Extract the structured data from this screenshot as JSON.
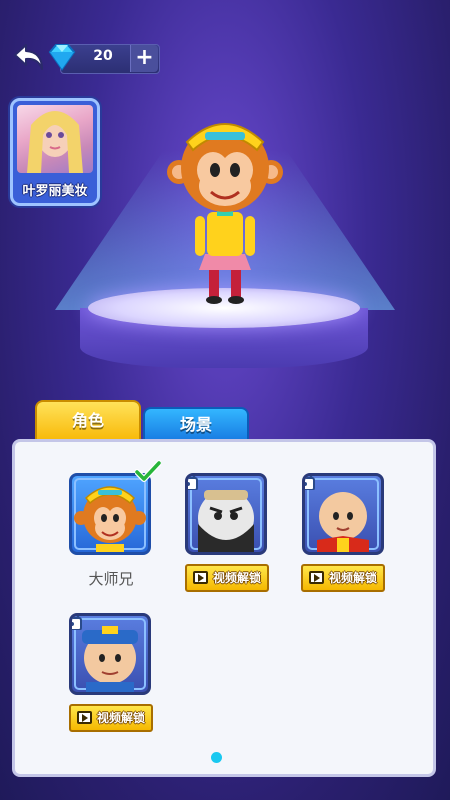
{
  "top_bar": {
    "gem_count": "20",
    "plus_label": "+"
  },
  "promo": {
    "label": "叶罗丽美妆"
  },
  "tabs": [
    {
      "label": "角色"
    },
    {
      "label": "场景"
    }
  ],
  "roles": [
    {
      "name": "大师兄",
      "status": "selected"
    },
    {
      "name": "",
      "status": "locked",
      "unlock_label": "视频解锁"
    },
    {
      "name": "",
      "status": "locked",
      "unlock_label": "视频解锁"
    },
    {
      "name": "",
      "status": "locked",
      "unlock_label": "视频解锁"
    }
  ],
  "pagination": {
    "current_page": 1,
    "total_pages": 1
  },
  "colors": {
    "tab_active": "#f7b500",
    "tab_inactive": "#1677e0",
    "button": "#f5b800",
    "accent": "#19c8f0"
  }
}
